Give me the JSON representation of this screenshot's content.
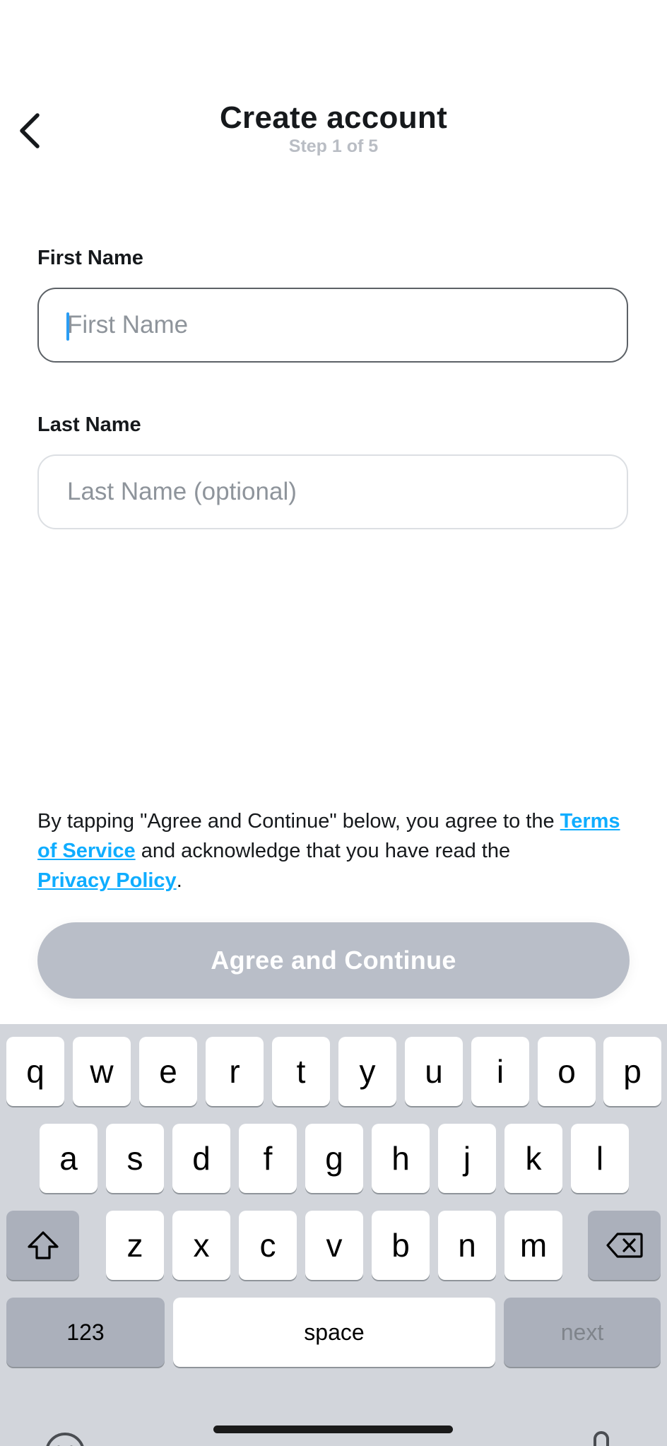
{
  "header": {
    "title": "Create account",
    "step": "Step 1 of 5"
  },
  "form": {
    "first_name": {
      "label": "First Name",
      "placeholder": "First Name",
      "value": ""
    },
    "last_name": {
      "label": "Last Name",
      "placeholder": "Last Name (optional)",
      "value": ""
    }
  },
  "terms": {
    "before": "By tapping \"Agree and Continue\" below, you agree to the ",
    "tos_link": "Terms of Service",
    "middle": " and acknowledge that you have read the ",
    "privacy_link": "Privacy Policy",
    "after": "."
  },
  "cta": {
    "label": "Agree and Continue"
  },
  "keyboard": {
    "row1": [
      "q",
      "w",
      "e",
      "r",
      "t",
      "y",
      "u",
      "i",
      "o",
      "p"
    ],
    "row2": [
      "a",
      "s",
      "d",
      "f",
      "g",
      "h",
      "j",
      "k",
      "l"
    ],
    "row3": [
      "z",
      "x",
      "c",
      "v",
      "b",
      "n",
      "m"
    ],
    "numbers_label": "123",
    "space_label": "space",
    "next_label": "next"
  },
  "colors": {
    "link": "#0fadff",
    "cta_disabled": "#b9bec8",
    "caret": "#2a9df4",
    "keyboard_bg": "#d2d5db"
  },
  "icons": {
    "back": "chevron-left-icon",
    "shift": "shift-icon",
    "delete": "backspace-icon",
    "emoji": "emoji-icon",
    "mic": "microphone-icon"
  }
}
